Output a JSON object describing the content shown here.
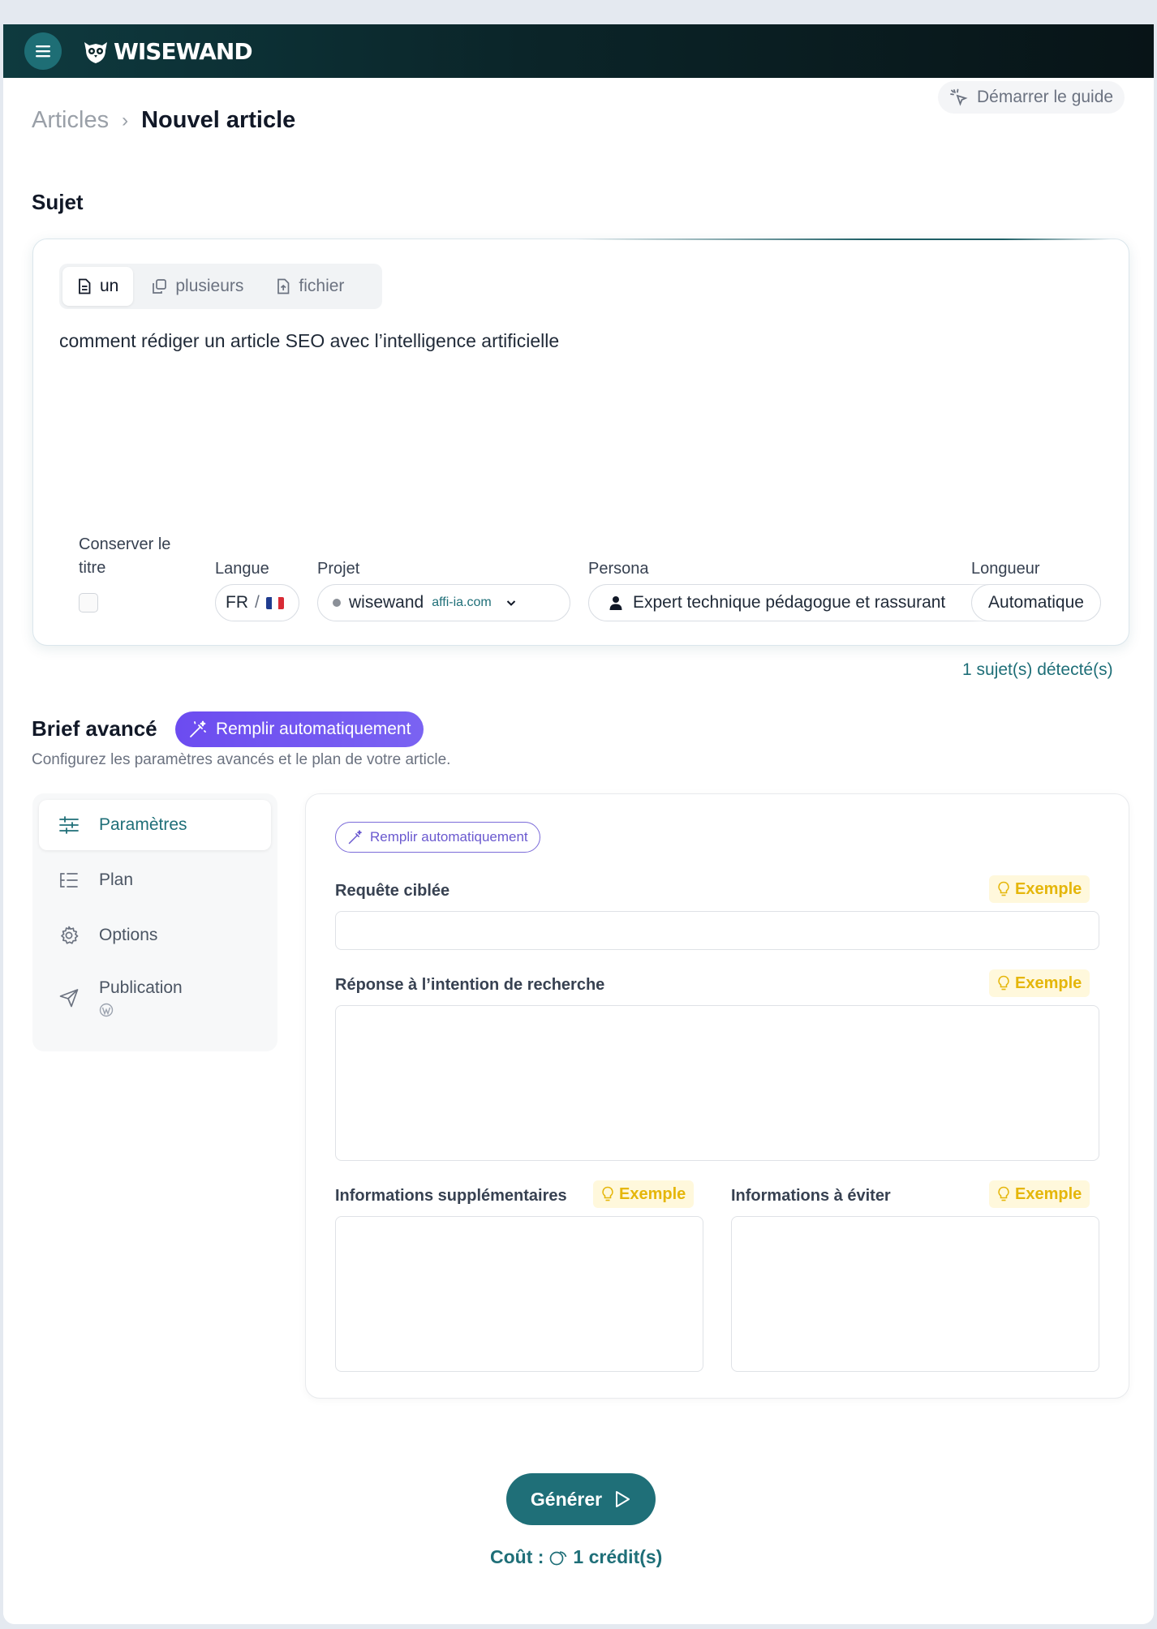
{
  "app": {
    "logo_text": "WISEWAND"
  },
  "header": {
    "guide_label": "Démarrer le guide"
  },
  "breadcrumb": {
    "parent": "Articles",
    "separator": "›",
    "current": "Nouvel article"
  },
  "subject": {
    "section_title": "Sujet",
    "tabs": [
      {
        "label": "un",
        "icon": "document-icon",
        "active": true
      },
      {
        "label": "plusieurs",
        "icon": "copy-icon",
        "active": false
      },
      {
        "label": "fichier",
        "icon": "file-upload-icon",
        "active": false
      }
    ],
    "text": "comment rédiger un article SEO avec l’intelligence artificielle",
    "keep_title_label_line1": "Conserver le",
    "keep_title_label_line2": "titre",
    "keep_title_checked": false,
    "language_label": "Langue",
    "language_code": "FR",
    "language_sep": "/",
    "project_label": "Projet",
    "project_name": "wisewand",
    "project_domain": "affi-ia.com",
    "persona_label": "Persona",
    "persona_value": "Expert technique pédagogue et rassurant",
    "length_label": "Longueur",
    "length_value": "Automatique",
    "detected": "1 sujet(s) détecté(s)"
  },
  "brief": {
    "title": "Brief avancé",
    "autofill_label": "Remplir automatiquement",
    "subtitle": "Configurez les paramètres avancés et le plan de votre article.",
    "nav": [
      {
        "label": "Paramètres",
        "icon": "sliders-icon",
        "active": true
      },
      {
        "label": "Plan",
        "icon": "outline-list-icon",
        "active": false
      },
      {
        "label": "Options",
        "icon": "gear-icon",
        "active": false
      },
      {
        "label": "Publication",
        "icon": "send-icon",
        "active": false
      }
    ],
    "params": {
      "autofill_label": "Remplir automatiquement",
      "example_label": "Exemple",
      "target_query_label": "Requête ciblée",
      "target_query_value": "",
      "intent_label": "Réponse à l’intention de recherche",
      "intent_value": "",
      "extra_info_label": "Informations supplémentaires",
      "extra_info_value": "",
      "avoid_info_label": "Informations à éviter",
      "avoid_info_value": ""
    }
  },
  "footer": {
    "generate_label": "Générer",
    "cost_label": "Coût :",
    "cost_value": "1 crédit(s)"
  },
  "colors": {
    "primary": "#1f6f78",
    "accent_purple": "#6c4cf0",
    "example_yellow": "#e5b60a",
    "topbar": "#0b2529"
  }
}
